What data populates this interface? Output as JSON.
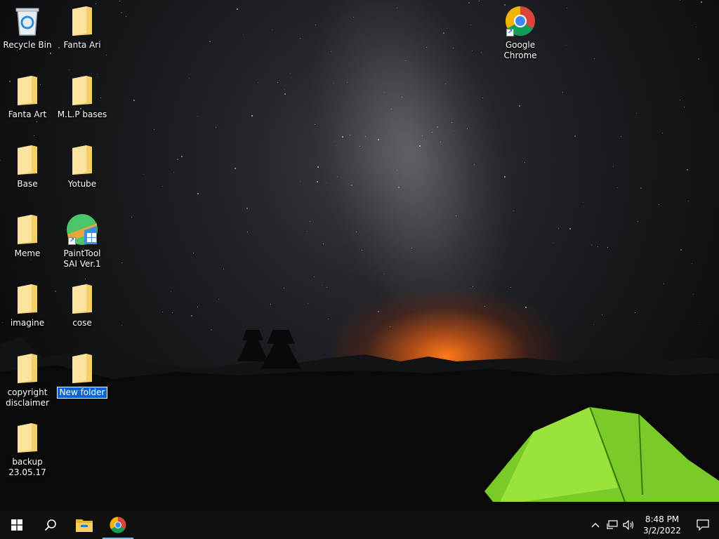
{
  "desktop": {
    "icons": [
      {
        "label": "Recycle Bin",
        "type": "recycle-bin"
      },
      {
        "label": "Fanta Ari",
        "type": "folder"
      },
      {
        "label": "Google Chrome",
        "type": "chrome-shortcut"
      },
      {
        "label": "Fanta Art",
        "type": "folder"
      },
      {
        "label": "M.L.P bases",
        "type": "folder"
      },
      {
        "label": "Base",
        "type": "folder"
      },
      {
        "label": "Yotube",
        "type": "folder"
      },
      {
        "label": "Meme",
        "type": "folder"
      },
      {
        "label": "PaintTool SAI Ver.1",
        "type": "app-shortcut"
      },
      {
        "label": "imagine",
        "type": "folder"
      },
      {
        "label": "cose",
        "type": "folder"
      },
      {
        "label": "copyright disclaimer",
        "type": "folder"
      },
      {
        "label": "New folder",
        "type": "folder",
        "renaming": true
      },
      {
        "label": "backup 23.05.17",
        "type": "folder"
      }
    ]
  },
  "taskbar": {
    "start": {
      "icon": "windows-logo-icon"
    },
    "search": {
      "icon": "search-icon"
    },
    "pinned": [
      {
        "name": "File Explorer",
        "icon": "file-explorer-icon"
      },
      {
        "name": "Google Chrome",
        "icon": "chrome-icon",
        "active": true
      }
    ],
    "tray": {
      "icons": [
        "chevron-up-icon",
        "network-icon",
        "volume-icon"
      ],
      "time": "8:48 PM",
      "date": "3/2/2022",
      "notification_icon": "action-center-icon"
    }
  },
  "colors": {
    "selection": "#0a64d8",
    "folder": "#f5cf6a",
    "taskbar": "#101010",
    "tent": "#7fd62b"
  }
}
